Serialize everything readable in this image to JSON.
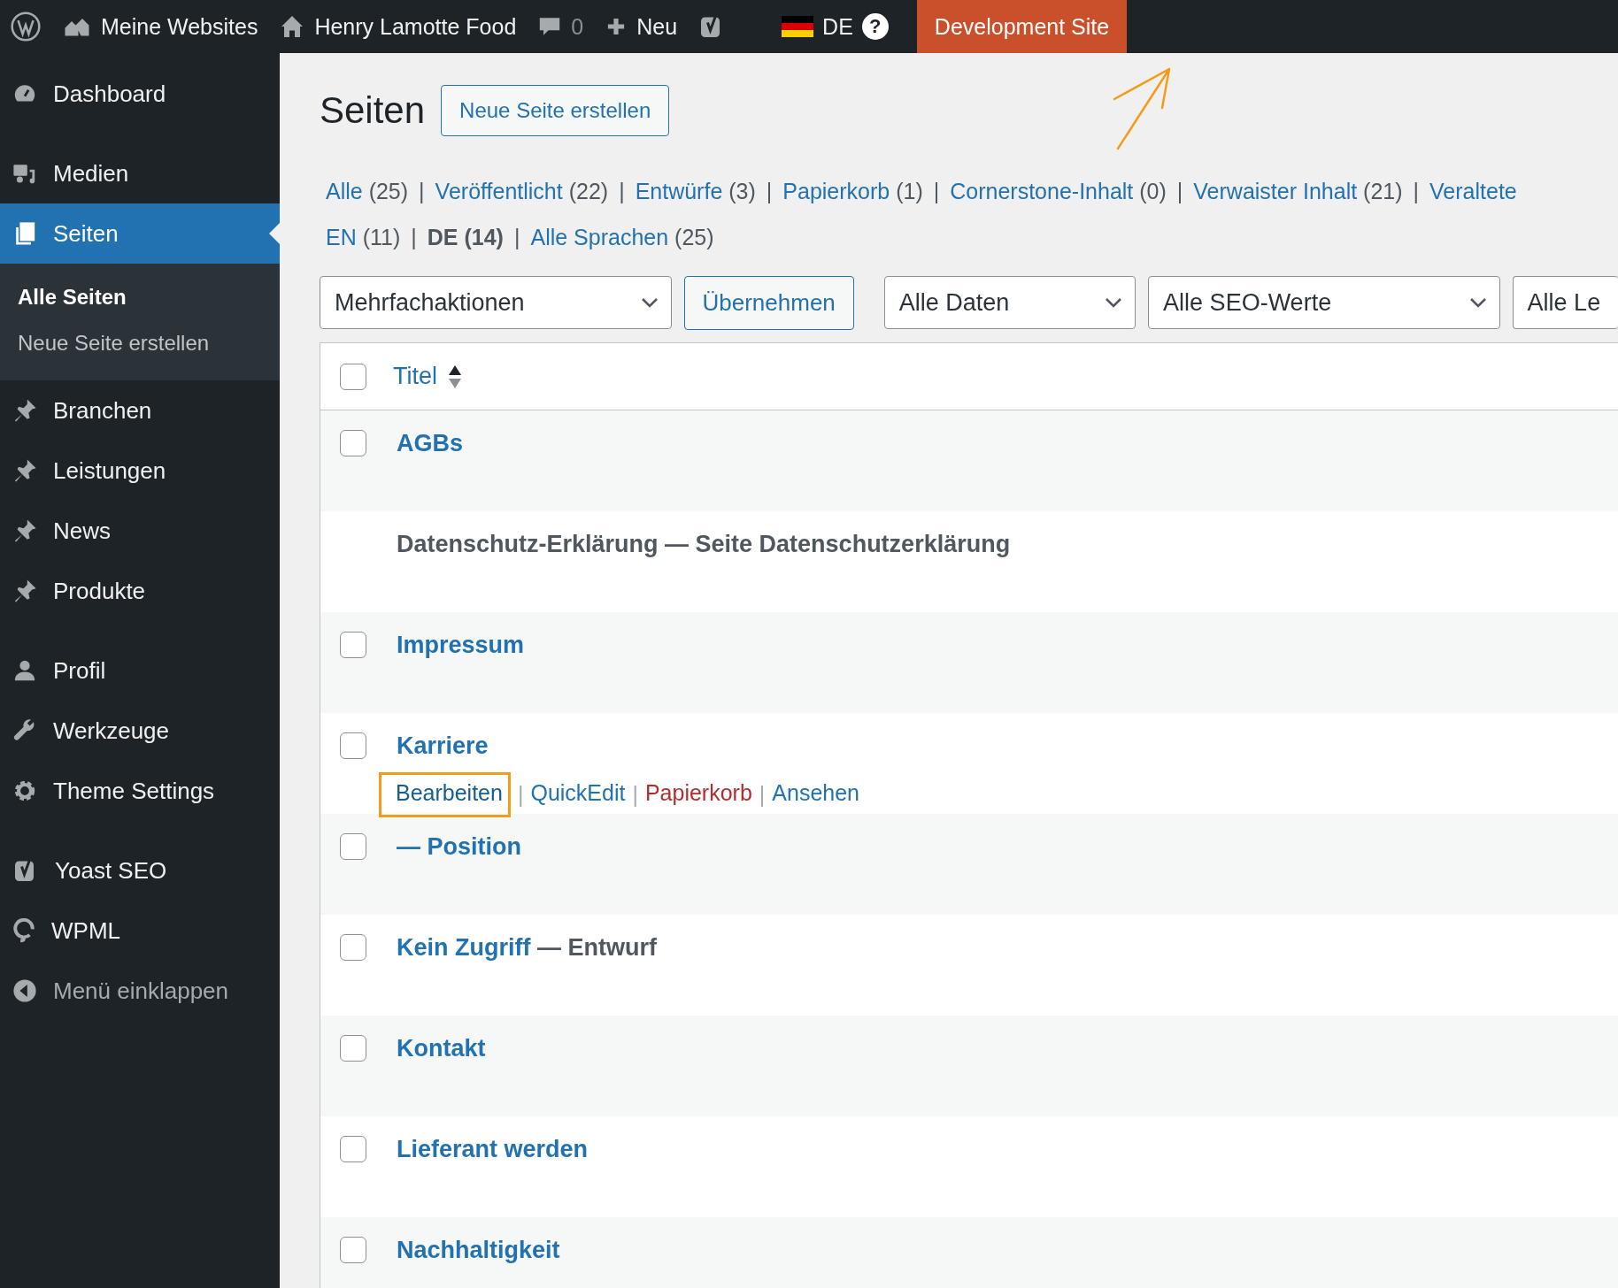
{
  "admin_bar": {
    "items": [
      {
        "kind": "wp"
      },
      {
        "kind": "sites",
        "label": "Meine Websites"
      },
      {
        "kind": "home",
        "label": "Henry Lamotte Food"
      },
      {
        "kind": "comments",
        "label": "0"
      },
      {
        "kind": "new",
        "label": "Neu"
      },
      {
        "kind": "yoast"
      },
      {
        "kind": "lang",
        "label": "DE",
        "help": "?"
      }
    ],
    "environment_badge": "Development Site"
  },
  "sidebar": {
    "sections": [
      {
        "items": [
          {
            "kind": "dashboard",
            "label": "Dashboard",
            "selected": false
          }
        ]
      },
      {
        "items": [
          {
            "kind": "media",
            "label": "Medien",
            "selected": false
          },
          {
            "kind": "pages",
            "label": "Seiten",
            "selected": true,
            "children": [
              {
                "label": "Alle Seiten",
                "selected": true
              },
              {
                "label": "Neue Seite erstellen",
                "selected": false
              }
            ]
          },
          {
            "kind": "pin",
            "label": "Branchen",
            "selected": false
          },
          {
            "kind": "pin",
            "label": "Leistungen",
            "selected": false
          },
          {
            "kind": "pin",
            "label": "News",
            "selected": false
          },
          {
            "kind": "pin",
            "label": "Produkte",
            "selected": false
          }
        ]
      },
      {
        "items": [
          {
            "kind": "user",
            "label": "Profil",
            "selected": false
          },
          {
            "kind": "wrench",
            "label": "Werkzeuge",
            "selected": false
          },
          {
            "kind": "gear",
            "label": "Theme Settings",
            "selected": false
          }
        ]
      },
      {
        "items": [
          {
            "kind": "yoast",
            "label": "Yoast SEO",
            "selected": false
          },
          {
            "kind": "wpml",
            "label": "WPML",
            "selected": false
          },
          {
            "kind": "collapse",
            "label": "Menü einklappen",
            "selected": false
          }
        ]
      }
    ]
  },
  "page": {
    "title": "Seiten",
    "add_button": "Neue Seite erstellen",
    "status_filters": [
      {
        "label": "Alle",
        "count": "(25)",
        "selected": false
      },
      {
        "separator": "|",
        "label": "Veröffentlicht",
        "count": "(22)",
        "selected": false
      },
      {
        "separator": "|",
        "label": "Entwürfe",
        "count": "(3)",
        "selected": false
      },
      {
        "separator": "|",
        "label": "Papierkorb",
        "count": "(1)",
        "selected": false
      },
      {
        "separator": "|",
        "label": "Cornerstone-Inhalt",
        "count": "(0)",
        "selected": false
      },
      {
        "separator": "|",
        "label": "Verwaister Inhalt",
        "count": "(21)",
        "selected": false
      },
      {
        "separator": "|",
        "label": "Veraltete",
        "selected": false
      }
    ],
    "language_filters": [
      {
        "label": "EN",
        "count": "(11)",
        "selected": false
      },
      {
        "separator": "|",
        "label": "DE",
        "count": "(14)",
        "selected": true
      },
      {
        "separator": "|",
        "label": "Alle Sprachen",
        "count": "(25)",
        "selected": false
      }
    ],
    "bulk_action": "Mehrfachaktionen",
    "apply_button": "Übernehmen",
    "date_filter": "Alle Daten",
    "seo_filter": "Alle SEO-Werte",
    "column_5_filter": "Alle Le",
    "table": {
      "title_column": "Titel",
      "select_all_checked": false,
      "rows": [
        {
          "title": "AGBs",
          "linked": true,
          "checked": false,
          "actions": []
        },
        {
          "title": "Datenschutz-Erklärung — Seite Datenschutzerklärung",
          "linked": false,
          "actions": []
        },
        {
          "title": "Impressum",
          "linked": true,
          "checked": false,
          "actions": []
        },
        {
          "title": "Karriere",
          "linked": true,
          "checked": false,
          "actions": [
            {
              "label": "Bearbeiten",
              "kind": "edit",
              "highlighted": true
            },
            {
              "separator": "|",
              "label": "QuickEdit",
              "kind": "edit",
              "highlighted": false
            },
            {
              "separator": "|",
              "label": "Papierkorb",
              "kind": "trash",
              "highlighted": false
            },
            {
              "separator": "|",
              "label": "Ansehen",
              "kind": "edit",
              "highlighted": false
            }
          ]
        },
        {
          "title": "— Position",
          "linked": true,
          "checked": false,
          "actions": []
        },
        {
          "title": "Kein Zugriff",
          "suffix": "— Entwurf",
          "linked": true,
          "checked": false,
          "actions": []
        },
        {
          "title": "Kontakt",
          "linked": true,
          "checked": false,
          "actions": []
        },
        {
          "title": "Lieferant werden",
          "linked": true,
          "checked": false,
          "actions": []
        },
        {
          "title": "Nachhaltigkeit",
          "linked": true,
          "checked": false,
          "actions": []
        }
      ]
    }
  }
}
